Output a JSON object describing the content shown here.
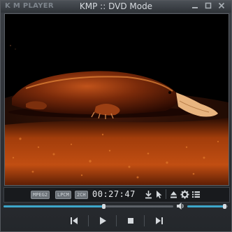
{
  "window": {
    "logo_text": "K M PLAYER",
    "title": "KMP :: DVD Mode",
    "buttons": [
      "minimize",
      "maximize",
      "close"
    ]
  },
  "video": {
    "description_hidden": true
  },
  "status": {
    "tags": [
      "MPEG2",
      "LPCM",
      "2CH"
    ],
    "time": "00:27:47",
    "icons": [
      "download-icon",
      "cursor-icon",
      "eject-icon",
      "gear-icon",
      "playlist-icon"
    ]
  },
  "seek": {
    "progress": 0.59
  },
  "volume": {
    "level": 0.95
  },
  "controls": {
    "buttons": [
      "previous",
      "play",
      "stop",
      "next"
    ]
  },
  "colors": {
    "accent": "#3ea6c9",
    "background": "#2b2e33"
  }
}
